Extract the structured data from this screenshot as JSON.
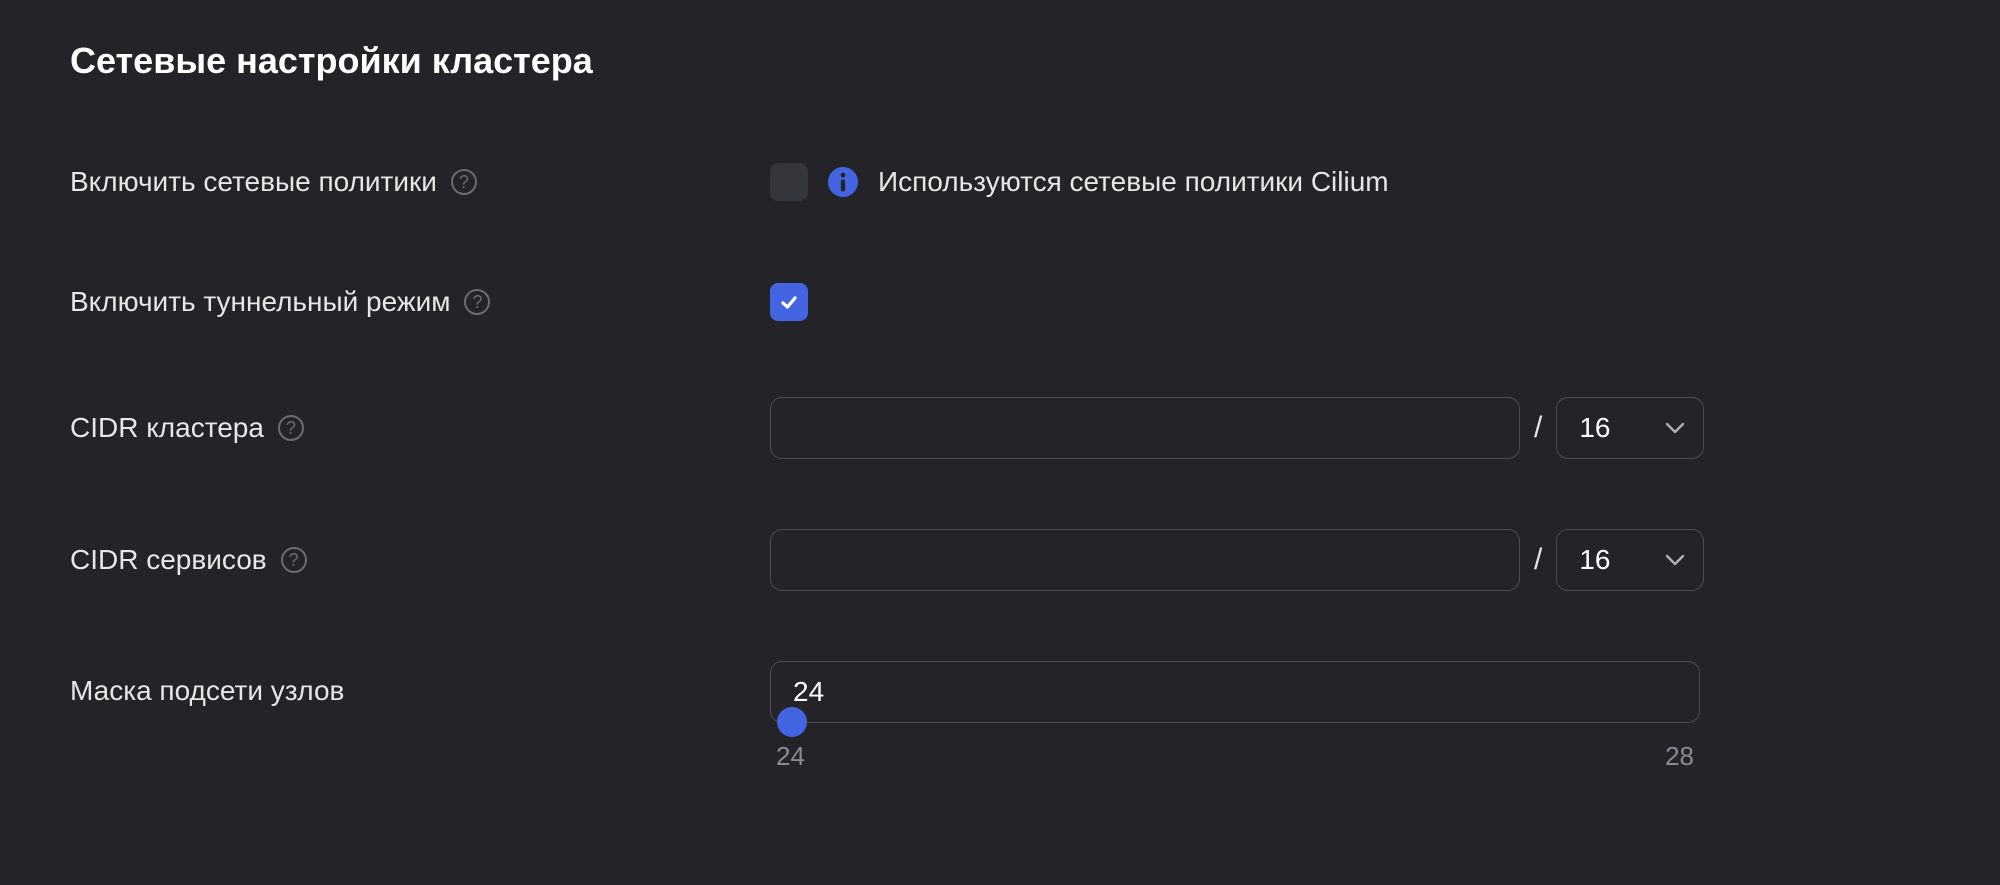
{
  "section": {
    "title": "Сетевые настройки кластера"
  },
  "rows": {
    "network_policies": {
      "label": "Включить сетевые политики",
      "checked": false,
      "info_text": "Используются сетевые политики Cilium"
    },
    "tunnel_mode": {
      "label": "Включить туннельный режим",
      "checked": true
    },
    "cluster_cidr": {
      "label": "CIDR кластера",
      "value": "",
      "mask": "16"
    },
    "services_cidr": {
      "label": "CIDR сервисов",
      "value": "",
      "mask": "16"
    },
    "node_subnet_mask": {
      "label": "Маска подсети узлов",
      "value": "24",
      "min": "24",
      "max": "28"
    }
  },
  "glyphs": {
    "help": "?",
    "slash": "/"
  }
}
